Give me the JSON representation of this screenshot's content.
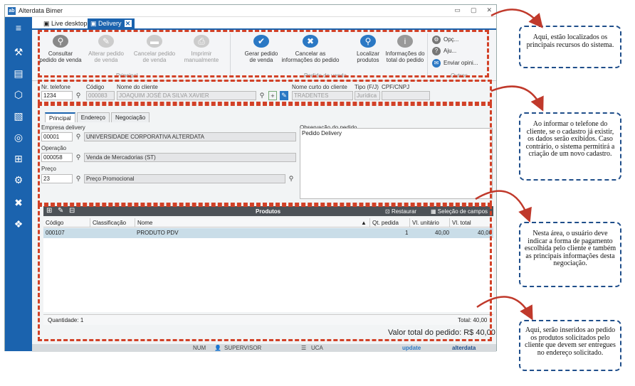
{
  "window": {
    "title": "Alterdata Bimer",
    "logo": "ab",
    "controls": [
      "▭",
      "▢",
      "✕"
    ]
  },
  "sidebar": {
    "icons": [
      {
        "name": "menu-icon",
        "glyph": "≡"
      },
      {
        "name": "tools-icon",
        "glyph": "⚒"
      },
      {
        "name": "id-card-icon",
        "glyph": "▤"
      },
      {
        "name": "boxes-icon",
        "glyph": "⬡"
      },
      {
        "name": "documents-icon",
        "glyph": "▧"
      },
      {
        "name": "coins-icon",
        "glyph": "◎"
      },
      {
        "name": "network-icon",
        "glyph": "⊞"
      },
      {
        "name": "settings-icon",
        "glyph": "⚙"
      },
      {
        "name": "delivery-icon",
        "glyph": "✖"
      },
      {
        "name": "apps-icon",
        "glyph": "❖"
      }
    ]
  },
  "tabs": [
    {
      "label": "Live desktop"
    },
    {
      "label": "Delivery",
      "close": "✕"
    }
  ],
  "ribbon": {
    "principal": {
      "label": "Principal",
      "buttons": [
        {
          "label1": "Consultar",
          "label2": "pedido de venda",
          "ul": "C",
          "icon": "search-icon",
          "glyph": "⚲",
          "color": "#888",
          "enabled": true
        },
        {
          "label1": "Alterar pedido",
          "label2": "de venda",
          "ul": "A",
          "icon": "pencil-icon",
          "glyph": "✎",
          "color": "#ccc",
          "enabled": false
        },
        {
          "label1": "Cancelar pedido",
          "label2": "de venda",
          "ul": "a",
          "icon": "cancel-doc-icon",
          "glyph": "▬",
          "color": "#ccc",
          "enabled": false
        },
        {
          "label1": "Imprimir",
          "label2": "manualmente",
          "ul": "m",
          "icon": "printer-icon",
          "glyph": "⎙",
          "color": "#ccc",
          "enabled": false
        }
      ]
    },
    "pedido": {
      "label": "Pedido de venda",
      "buttons": [
        {
          "label1": "Gerar pedido",
          "label2": "de venda",
          "ul": "G",
          "icon": "generate-order-icon",
          "glyph": "✔",
          "color": "#2b78c4",
          "enabled": true
        },
        {
          "label1": "Cancelar as",
          "label2": "informações do pedido",
          "ul": "C",
          "icon": "cancel-order-icon",
          "glyph": "✖",
          "color": "#2b78c4",
          "enabled": true
        },
        {
          "label1": "Localizar",
          "label2": "produtos",
          "ul": "L",
          "icon": "find-products-icon",
          "glyph": "⚲",
          "color": "#2b78c4",
          "enabled": true
        },
        {
          "label1": "Informações do",
          "label2": "total do pedido",
          "ul": "I",
          "icon": "info-icon",
          "glyph": "i",
          "color": "#999",
          "enabled": true
        }
      ]
    },
    "outros": {
      "label": "Outros",
      "items": [
        {
          "label": "Opç...",
          "icon": "gear-icon",
          "glyph": "⚙"
        },
        {
          "label": "Aju...",
          "icon": "help-icon",
          "glyph": "?"
        },
        {
          "label": "Enviar opini...",
          "icon": "feedback-icon",
          "glyph": "✉"
        }
      ]
    }
  },
  "customer": {
    "phone_label": "Nr. telefone",
    "phone": "1234",
    "code_label": "Código",
    "code": "000083",
    "name_label": "Nome do cliente",
    "name": "JOAQUIM JOSÉ DA SILVA XAVIER",
    "short_label": "Nome curto do cliente",
    "short": "TRADENTES",
    "type_label": "Tipo (F/J)",
    "type": "Jurídica",
    "cpf_label": "CPF/CNPJ",
    "cpf": ""
  },
  "form_tabs": [
    "Principal",
    "Endereço",
    "Negociação"
  ],
  "principal": {
    "empresa_label": "Empresa delivery",
    "empresa_code": "00001",
    "empresa_name": "UNIVERSIDADE CORPORATIVA ALTERDATA",
    "operacao_label": "Operação",
    "operacao_code": "000058",
    "operacao_name": "Venda de Mercadorias (ST)",
    "preco_label": "Preço",
    "preco_code": "23",
    "preco_name": "Preço Promocional",
    "obs_label": "Observação do pedido",
    "obs": "Pedido Delivery"
  },
  "products": {
    "title": "Produtos",
    "restore": "Restaurar",
    "fields": "Seleção de campos",
    "columns": [
      "Código",
      "Classificação",
      "Nome",
      "Qt. pedida",
      "Vl. unitário",
      "Vl. total"
    ],
    "rows": [
      {
        "code": "000107",
        "class": "",
        "name": "PRODUTO PDV",
        "qty": "1",
        "unit": "40,00",
        "total": "40,00"
      }
    ],
    "quantity": "Quantidade: 1",
    "total": "Total: 40,00"
  },
  "order_total": "Valor total do pedido: R$ 40,00",
  "status": {
    "num": "NUM",
    "user": "SUPERVISOR",
    "db": "UCA",
    "brand1": "update",
    "brand2": "alterdata"
  },
  "notes": [
    "Aqui, estão localizados os principais recursos do sistema.",
    "Ao informar o telefone do cliente, se o cadastro já existir, os dados serão exibidos. Caso contrário, o sistema permitirá a criação de um novo cadastro.",
    "Nesta área, o usuário deve indicar a forma de pagamento escolhida pelo cliente e também as principais informações desta negociação.",
    "Aqui, serão inseridos ao pedido os produtos solicitados pelo cliente que devem ser entregues no endereço solicitado."
  ],
  "colors": {
    "accent": "#1b63ae",
    "dash": "#d24127",
    "note_border": "#1f4e8a",
    "arrow": "#c0392b"
  }
}
